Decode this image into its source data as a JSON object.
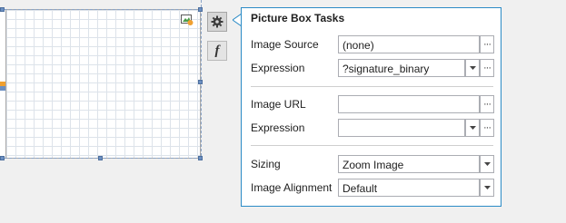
{
  "panel": {
    "title": "Picture Box Tasks",
    "image_source": {
      "label": "Image Source",
      "value": "(none)"
    },
    "expression1": {
      "label": "Expression",
      "value": "?signature_binary"
    },
    "image_url": {
      "label": "Image URL",
      "value": ""
    },
    "expression2": {
      "label": "Expression",
      "value": ""
    },
    "sizing": {
      "label": "Sizing",
      "value": "Zoom Image"
    },
    "alignment": {
      "label": "Image Alignment",
      "value": "Default"
    },
    "ellipsis": "···"
  },
  "icons": {
    "smart_tag": "gear-icon",
    "expression": "function-icon",
    "dropdown": "chevron-down-icon",
    "picture": "picture-icon"
  },
  "colors": {
    "panel_border": "#2b8bc6",
    "handle": "#6b8fc2",
    "warning": "#f0a030"
  }
}
